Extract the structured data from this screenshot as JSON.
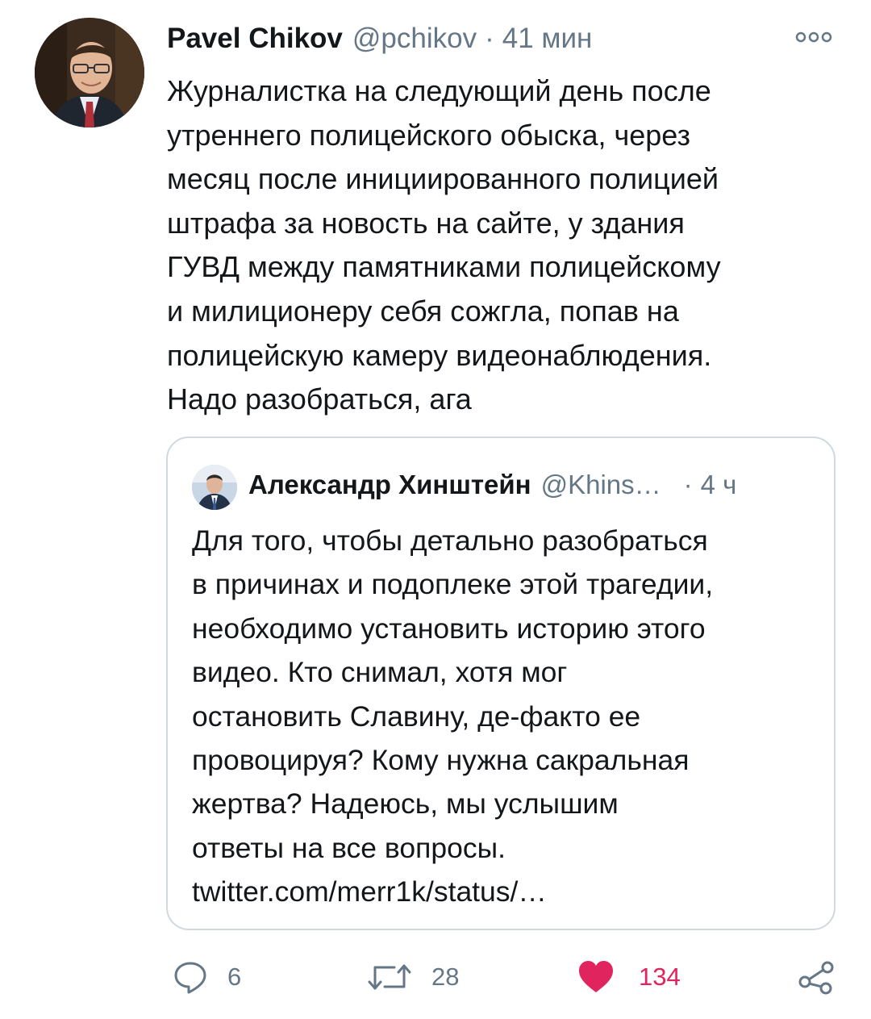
{
  "tweet": {
    "author_name": "Pavel Chikov",
    "author_handle": "@pchikov",
    "separator": "·",
    "time": "41 мин",
    "text": "Журналистка на следующий день после\nутреннего полицейского обыска, через\nмесяц после инициированного полицией\nштрафа за новость на сайте, у здания\nГУВД между памятниками полицейскому\nи милиционеру себя сожгла, попав на\nполицейскую камеру видеонаблюдения.\nНадо разобраться, ага",
    "more_icon": "more-options-icon"
  },
  "quoted_tweet": {
    "author_name": "Александр Хинштейн",
    "author_handle": "@Khins…",
    "separator": "·",
    "time": "4 ч",
    "text": "Для того, чтобы детально разобраться\nв причинах и подоплеке этой трагедии,\nнеобходимо установить историю этого\nвидео. Кто снимал, хотя мог\nостановить Славину, де-факто ее\nпровоцируя? Кому нужна сакральная\nжертва? Надеюсь, мы услышим\nответы на все вопросы.\ntwitter.com/merr1k/status/…"
  },
  "actions": {
    "reply": {
      "icon": "reply-icon",
      "count": "6"
    },
    "retweet": {
      "icon": "retweet-icon",
      "count": "28"
    },
    "like": {
      "icon": "heart-icon",
      "count": "134"
    },
    "share": {
      "icon": "share-icon"
    }
  },
  "colors": {
    "text": "#14171a",
    "secondary": "#657786",
    "like": "#e0245e",
    "border": "#cfd9de"
  }
}
